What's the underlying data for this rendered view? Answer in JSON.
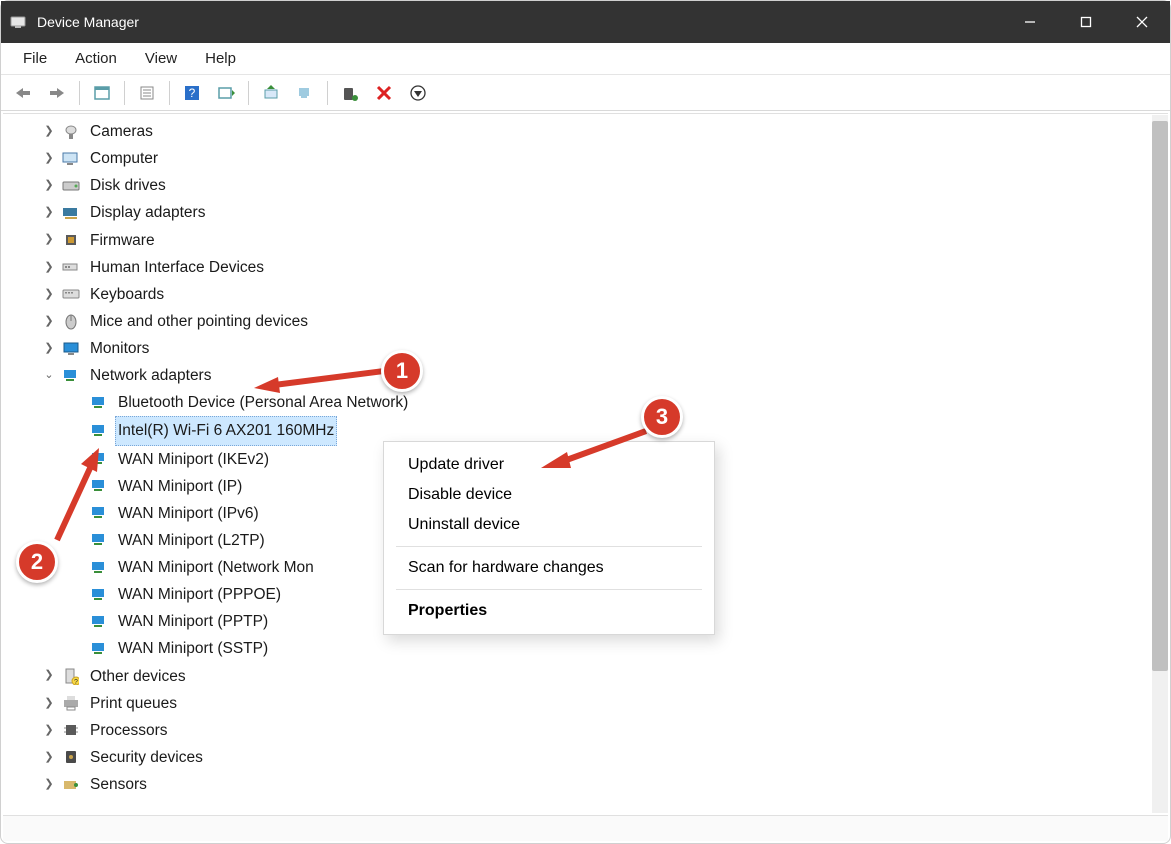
{
  "window": {
    "title": "Device Manager"
  },
  "menubar": {
    "file": "File",
    "action": "Action",
    "view": "View",
    "help": "Help"
  },
  "tree": {
    "cameras": "Cameras",
    "computer": "Computer",
    "disk_drives": "Disk drives",
    "display_adapters": "Display adapters",
    "firmware": "Firmware",
    "hid": "Human Interface Devices",
    "keyboards": "Keyboards",
    "mice": "Mice and other pointing devices",
    "monitors": "Monitors",
    "network_adapters": "Network adapters",
    "net_children": {
      "bt": "Bluetooth Device (Personal Area Network)",
      "wifi": "Intel(R) Wi-Fi 6 AX201 160MHz",
      "wan_ikev2": "WAN Miniport (IKEv2)",
      "wan_ip": "WAN Miniport (IP)",
      "wan_ipv6": "WAN Miniport (IPv6)",
      "wan_l2tp": "WAN Miniport (L2TP)",
      "wan_netmon": "WAN Miniport (Network Mon",
      "wan_pppoe": "WAN Miniport (PPPOE)",
      "wan_pptp": "WAN Miniport (PPTP)",
      "wan_sstp": "WAN Miniport (SSTP)"
    },
    "other_devices": "Other devices",
    "print_queues": "Print queues",
    "processors": "Processors",
    "security_devices": "Security devices",
    "sensors": "Sensors"
  },
  "contextmenu": {
    "update": "Update driver",
    "disable": "Disable device",
    "uninstall": "Uninstall device",
    "scan": "Scan for hardware changes",
    "properties": "Properties"
  },
  "annotations": {
    "b1": "1",
    "b2": "2",
    "b3": "3"
  }
}
